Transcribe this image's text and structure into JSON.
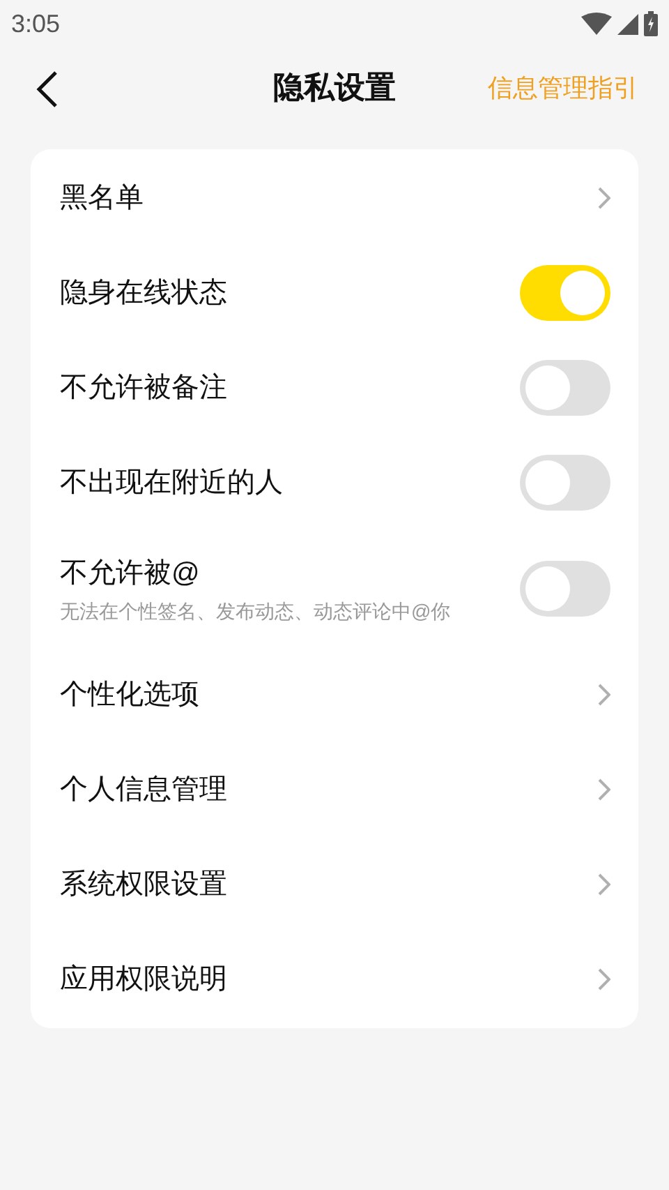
{
  "status_bar": {
    "time": "3:05"
  },
  "header": {
    "title": "隐私设置",
    "action": "信息管理指引"
  },
  "items": [
    {
      "kind": "link",
      "label": "黑名单"
    },
    {
      "kind": "toggle",
      "label": "隐身在线状态",
      "on": true
    },
    {
      "kind": "toggle",
      "label": "不允许被备注",
      "on": false
    },
    {
      "kind": "toggle",
      "label": "不出现在附近的人",
      "on": false
    },
    {
      "kind": "toggle",
      "label": "不允许被@",
      "description": "无法在个性签名、发布动态、动态评论中@你",
      "on": false
    },
    {
      "kind": "link",
      "label": "个性化选项"
    },
    {
      "kind": "link",
      "label": "个人信息管理"
    },
    {
      "kind": "link",
      "label": "系统权限设置"
    },
    {
      "kind": "link",
      "label": "应用权限说明"
    }
  ]
}
